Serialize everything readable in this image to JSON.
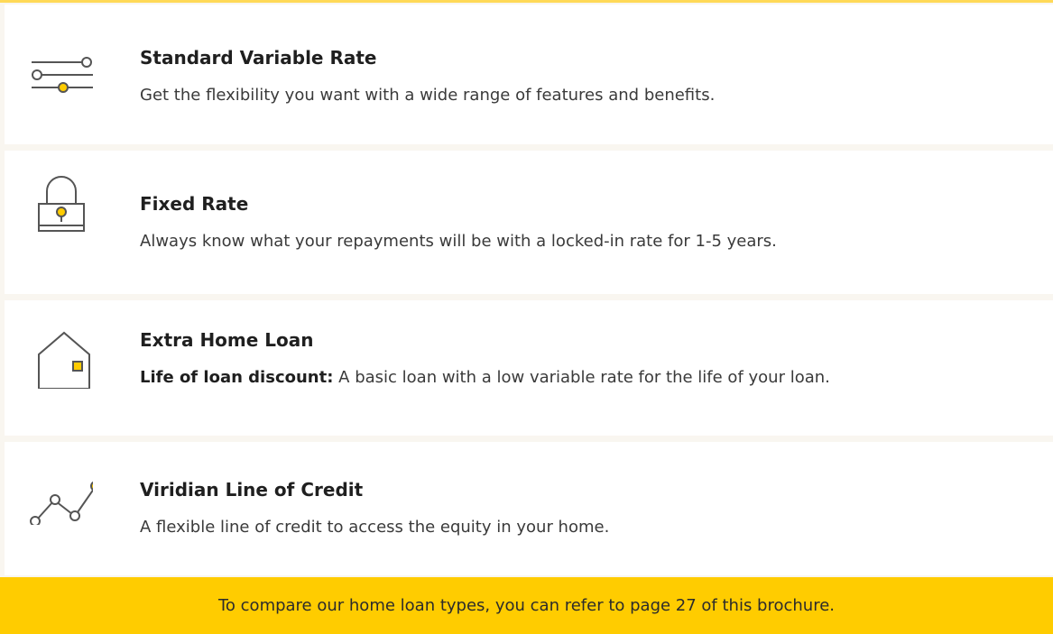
{
  "loan_types": [
    {
      "icon": "sliders-icon",
      "title": "Standard Variable Rate",
      "description": "Get the flexibility you want with a wide range of features and benefits."
    },
    {
      "icon": "padlock-icon",
      "title": "Fixed Rate",
      "description": "Always know what your repayments will be with a locked-in rate for 1-5 years."
    },
    {
      "icon": "house-icon",
      "title": "Extra Home Loan",
      "description_lead": "Life of loan discount:",
      "description": "A basic loan with a low variable rate for the life of your loan."
    },
    {
      "icon": "line-graph-icon",
      "title": "Viridian Line of Credit",
      "description": "A flexible line of credit to access the equity in your home."
    }
  ],
  "footer": {
    "text": "To compare our home loan types, you can refer to page 27 of this brochure."
  },
  "colors": {
    "accent_yellow": "#ffcc00",
    "icon_stroke": "#555555",
    "background": "#f9f6f0",
    "card": "#ffffff"
  }
}
